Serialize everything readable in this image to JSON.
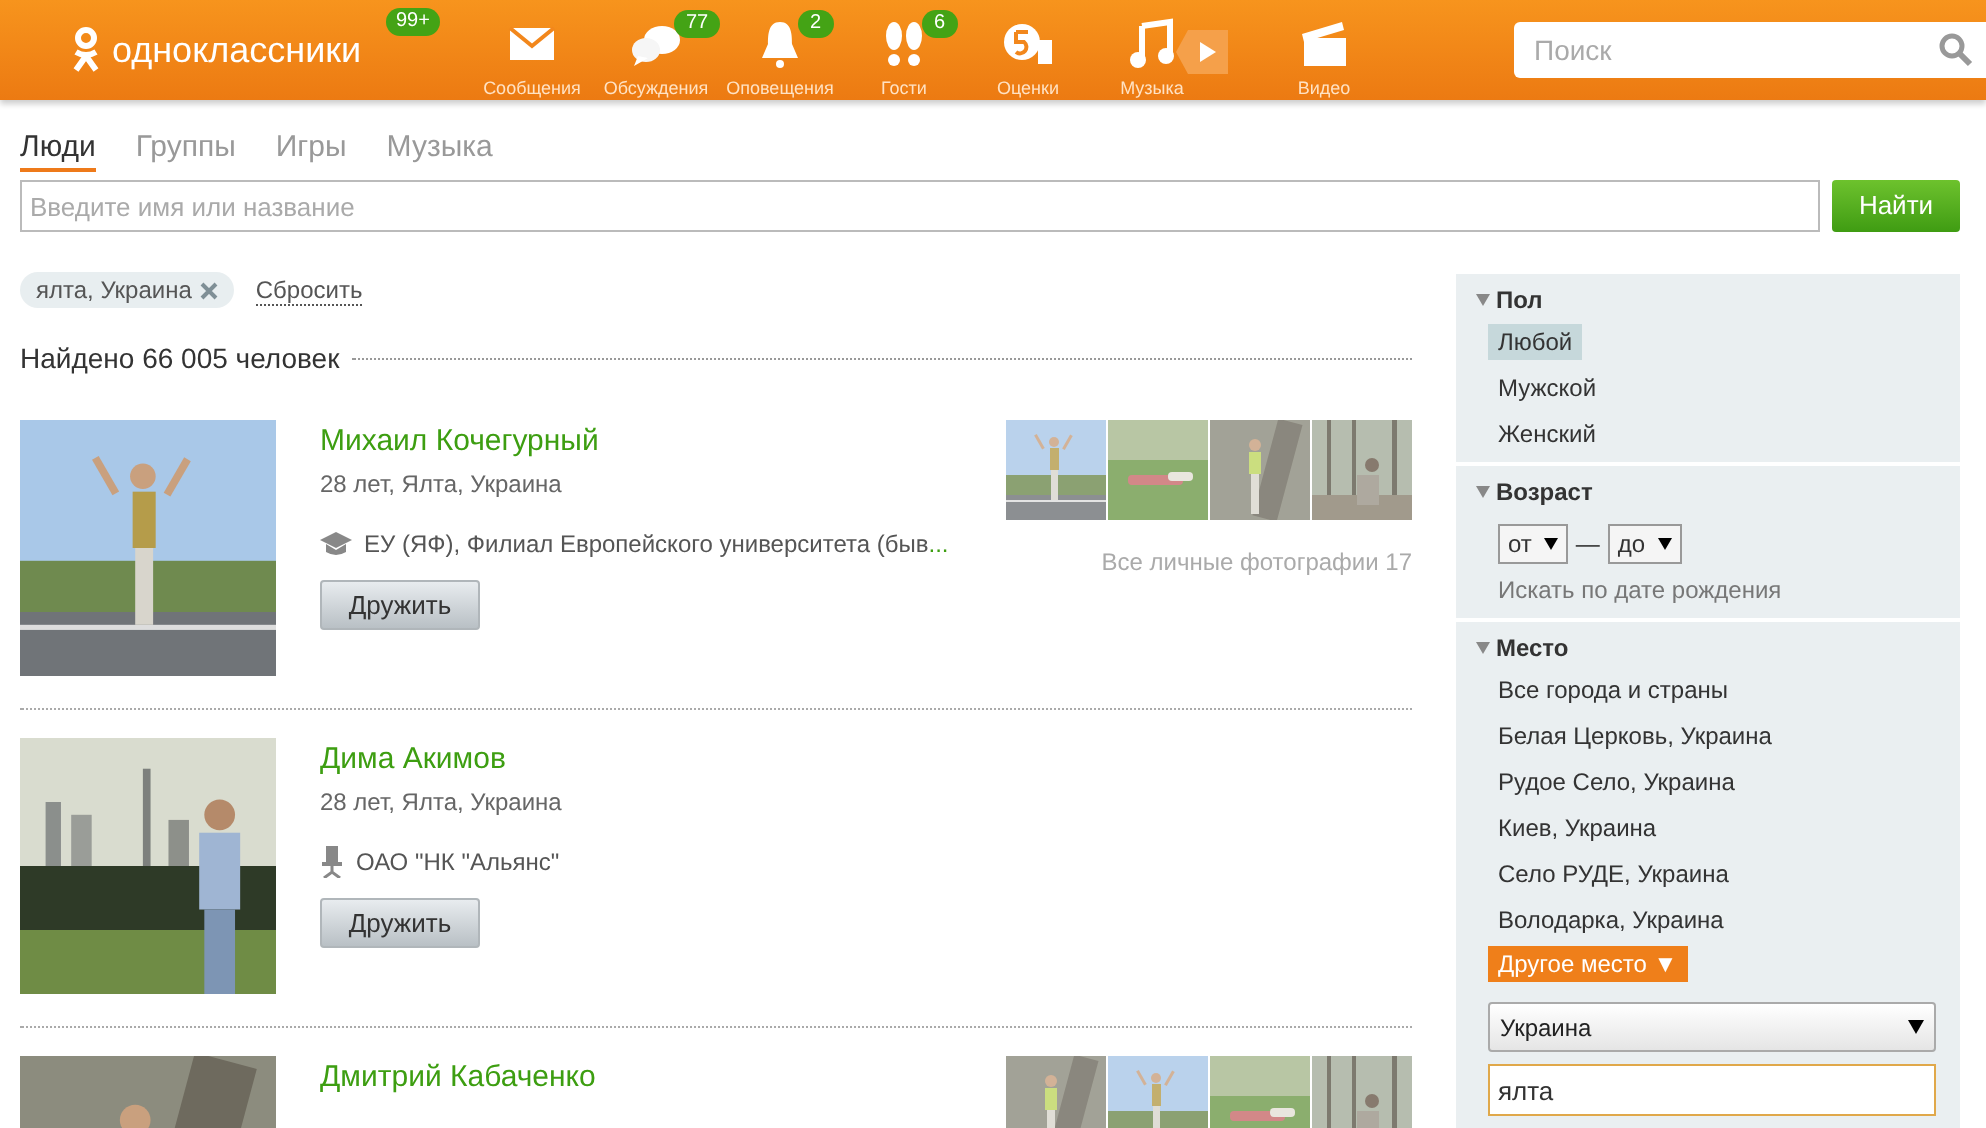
{
  "header": {
    "logo": "одноклассники",
    "logo_badge": "99+",
    "nav": [
      {
        "kind": "mail",
        "label": "Сообщения"
      },
      {
        "kind": "chat",
        "label": "Обсуждения",
        "badge": "77"
      },
      {
        "kind": "bell",
        "label": "Оповещения",
        "badge": "2"
      },
      {
        "kind": "feet",
        "label": "Гости",
        "badge": "6"
      },
      {
        "kind": "rating",
        "label": "Оценки"
      },
      {
        "kind": "music",
        "label": "Музыка"
      },
      {
        "kind": "video",
        "label": "Видео"
      }
    ],
    "search": {
      "placeholder": "Поиск"
    }
  },
  "tabs": [
    {
      "label": "Люди",
      "selected": true
    },
    {
      "label": "Группы",
      "selected": false
    },
    {
      "label": "Игры",
      "selected": false
    },
    {
      "label": "Музыка",
      "selected": false
    }
  ],
  "query": {
    "placeholder": "Введите имя или название",
    "button": "Найти"
  },
  "filter_chip": "ялта, Украина",
  "reset": "Сбросить",
  "found": "Найдено 66 005 человек",
  "people": [
    {
      "name": "Михаил Кочегурный",
      "info": "28 лет, Ялта, Украина",
      "detail": {
        "kind": "education",
        "text": "ЕУ (ЯФ), Филиал Европейского университета (быв",
        "more": "..."
      },
      "button": "Дружить",
      "photos_link": "Все личные фотографии",
      "photos_count": "17"
    },
    {
      "name": "Дима Акимов",
      "info": "28 лет, Ялта, Украина",
      "detail": {
        "kind": "work",
        "text": "ОАО \"НК \"Альянс\""
      },
      "button": "Дружить"
    },
    {
      "name": "Дмитрий Кабаченко"
    }
  ],
  "sidebar": {
    "sections": [
      {
        "kind": "options",
        "title": "Пол",
        "options": [
          {
            "label": "Любой",
            "selected": true
          },
          {
            "label": "Мужской",
            "selected": false
          },
          {
            "label": "Женский",
            "selected": false
          }
        ]
      },
      {
        "kind": "range",
        "title": "Возраст",
        "from": "от",
        "to": "до",
        "dash": "—",
        "link": "Искать по дате рождения"
      },
      {
        "kind": "place",
        "title": "Место",
        "options": [
          {
            "label": "Все города и страны"
          },
          {
            "label": "Белая Церковь, Украина"
          },
          {
            "label": "Рудое Село, Украина"
          },
          {
            "label": "Киев, Украина"
          },
          {
            "label": "Село РУДЕ, Украина"
          },
          {
            "label": "Володарка, Украина"
          }
        ],
        "other": "Другое место ▼",
        "country": "Украина",
        "city": "ялта"
      }
    ]
  }
}
